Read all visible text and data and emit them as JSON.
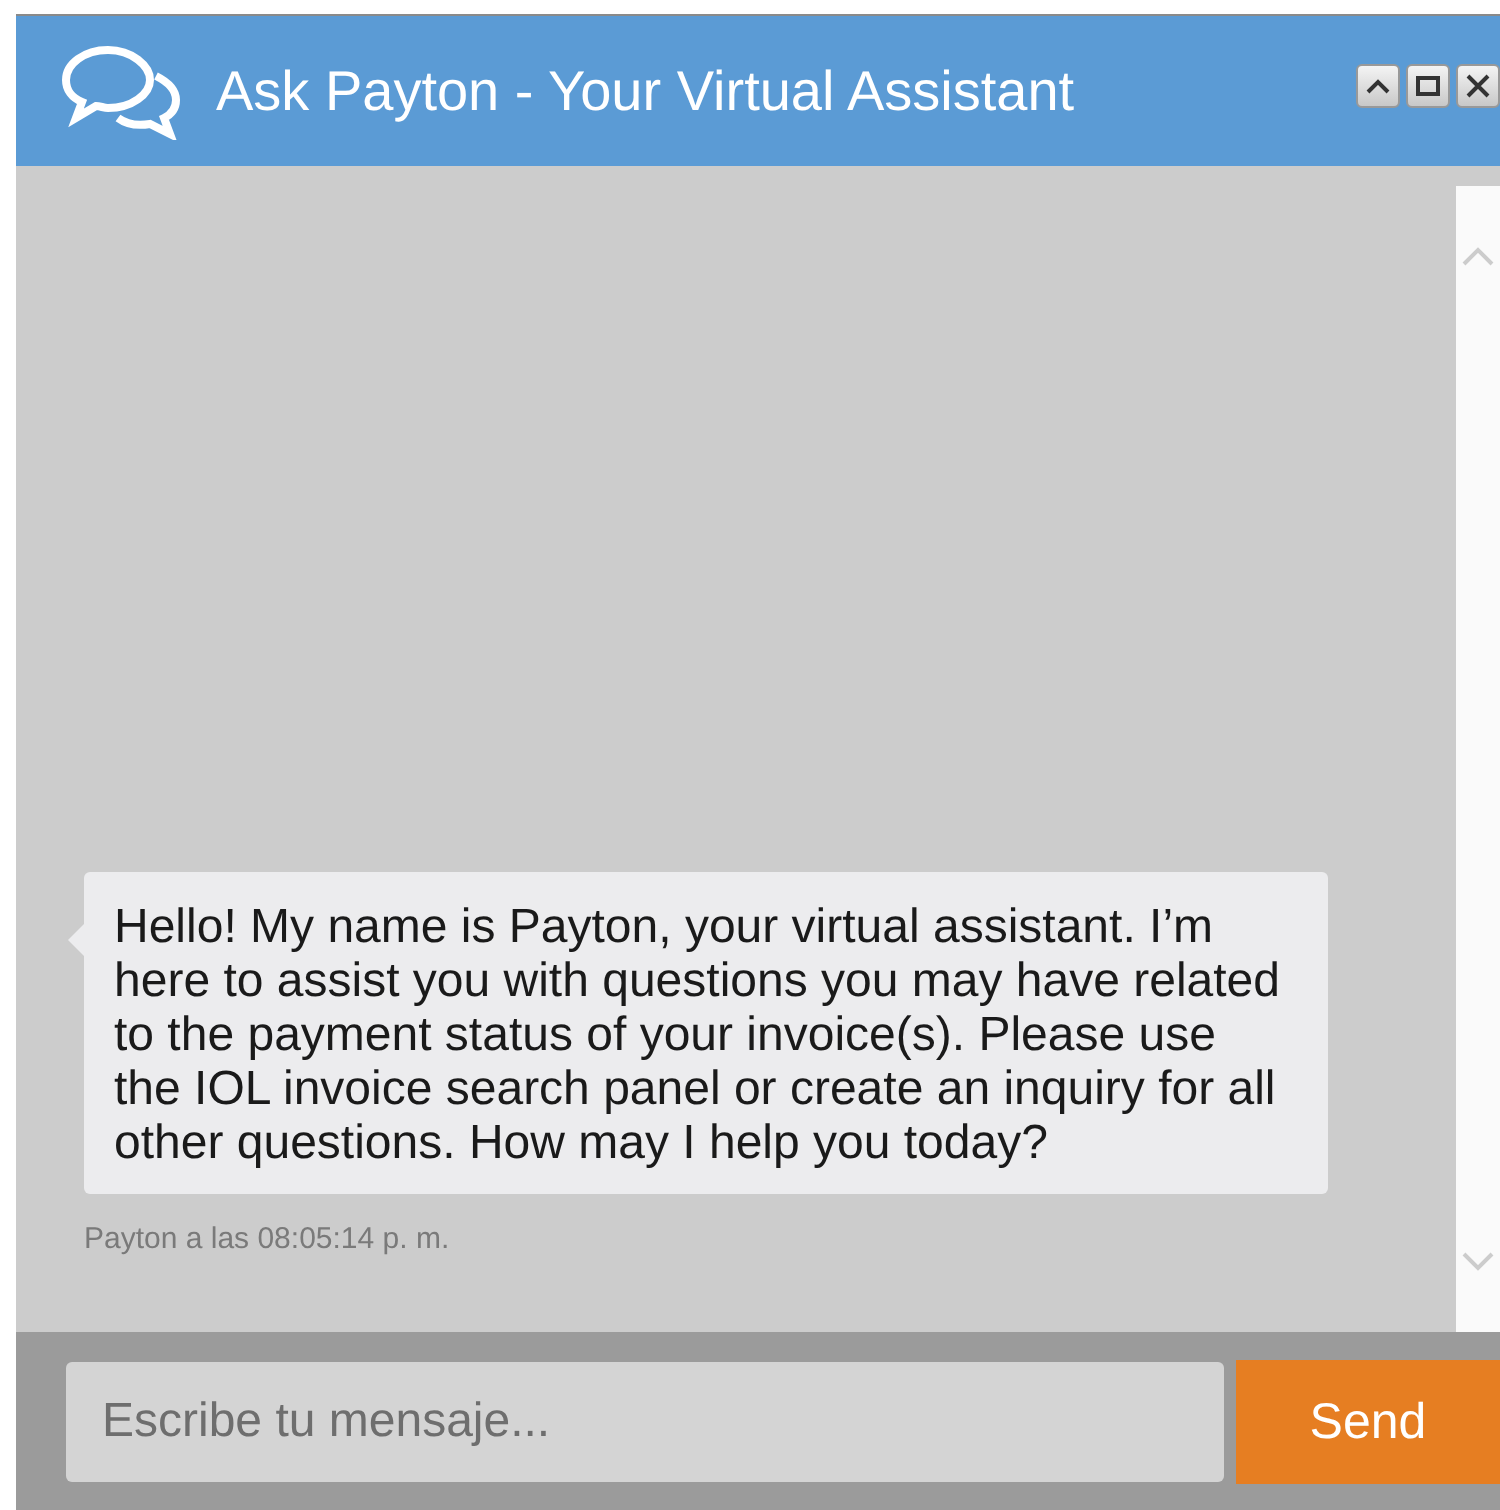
{
  "window": {
    "title": "Ask Payton - Your Virtual Assistant"
  },
  "messages": [
    {
      "text": "Hello! My name is Payton, your virtual assistant. I’m here to assist you with questions you may have related to the payment status of your invoice(s). Please use the IOL invoice search panel or create an inquiry for all other questions. How may I help you today?",
      "meta": "Payton a las 08:05:14 p. m."
    }
  ],
  "composer": {
    "placeholder": "Escribe tu mensaje...",
    "send": "Send"
  }
}
